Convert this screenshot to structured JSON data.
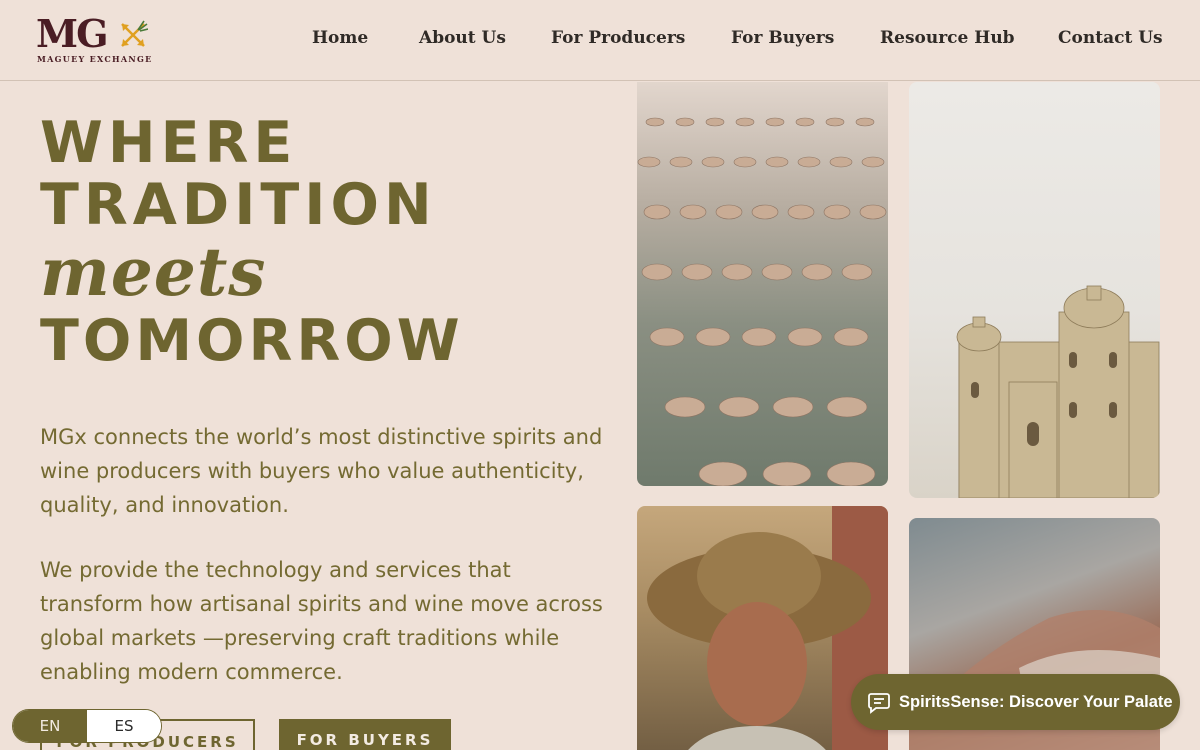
{
  "brand": {
    "logo_text": "MG",
    "logo_subtitle": "MAGUEY EXCHANGE",
    "colors": {
      "primary_olive": "#6e6530",
      "logo_maroon": "#4a1d24",
      "background": "#efe1d8",
      "accent_gold": "#e0a020"
    }
  },
  "nav": {
    "items": [
      {
        "label": "Home"
      },
      {
        "label": "About Us"
      },
      {
        "label": "For Producers"
      },
      {
        "label": "For Buyers"
      },
      {
        "label": "Resource Hub"
      },
      {
        "label": "Contact Us"
      }
    ]
  },
  "hero": {
    "title_line1": "WHERE",
    "title_line2": "TRADITION",
    "title_line3": "meets",
    "title_line4": "TOMORROW",
    "paragraph1": "MGx connects the world’s most distinctive spirits and wine producers with buyers who value authenticity, quality, and innovation.",
    "paragraph2": "We provide the technology and services that transform how artisanal spirits and wine move across global markets —preserving craft traditions while enabling modern commerce.",
    "btn_producers": "FOR PRODUCERS",
    "btn_buyers": "FOR BUYERS"
  },
  "lang_toggle": {
    "en": "EN",
    "es": "ES",
    "selected": "EN"
  },
  "photos": [
    {
      "subject": "bottles-with-corks"
    },
    {
      "subject": "colonial-church"
    },
    {
      "subject": "farmer-in-hat"
    },
    {
      "subject": "hand-closeup"
    }
  ],
  "chat": {
    "label": "SpiritsSense: Discover Your Palate",
    "icon": "chat-bubble-icon"
  }
}
